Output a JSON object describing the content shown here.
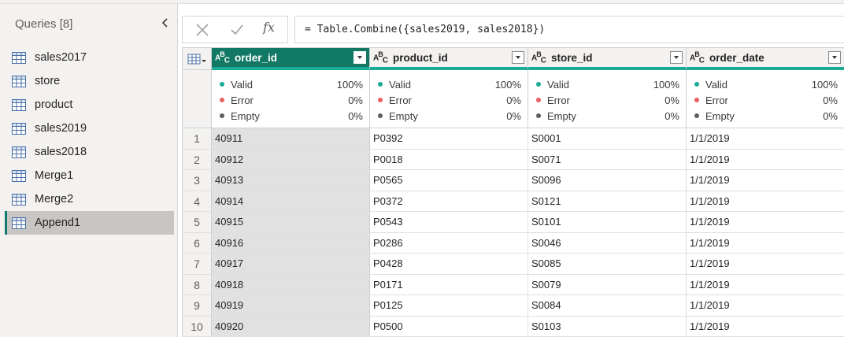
{
  "queries": {
    "title": "Queries [8]",
    "items": [
      {
        "label": "sales2017",
        "selected": false
      },
      {
        "label": "store",
        "selected": false
      },
      {
        "label": "product",
        "selected": false
      },
      {
        "label": "sales2019",
        "selected": false
      },
      {
        "label": "sales2018",
        "selected": false
      },
      {
        "label": "Merge1",
        "selected": false
      },
      {
        "label": "Merge2",
        "selected": false
      },
      {
        "label": "Append1",
        "selected": true
      }
    ]
  },
  "formula_bar": {
    "cancel_icon": "close-icon",
    "commit_icon": "check-icon",
    "function_icon": "fx-icon",
    "function_label": "fx",
    "formula": "= Table.Combine({sales2019, sales2018})"
  },
  "grid": {
    "columns": [
      {
        "name": "order_id",
        "type": "ABC",
        "selected": true,
        "profile": {
          "valid": "100%",
          "error": "0%",
          "empty": "0%"
        }
      },
      {
        "name": "product_id",
        "type": "ABC",
        "selected": false,
        "profile": {
          "valid": "100%",
          "error": "0%",
          "empty": "0%"
        }
      },
      {
        "name": "store_id",
        "type": "ABC",
        "selected": false,
        "profile": {
          "valid": "100%",
          "error": "0%",
          "empty": "0%"
        }
      },
      {
        "name": "order_date",
        "type": "ABC",
        "selected": false,
        "profile": {
          "valid": "100%",
          "error": "0%",
          "empty": "0%"
        }
      }
    ],
    "profile_labels": {
      "valid": "Valid",
      "error": "Error",
      "empty": "Empty"
    },
    "profile_colors": {
      "valid": "#1aab97",
      "error": "#e8615e",
      "empty": "#605e5c"
    },
    "rows": [
      {
        "n": "1",
        "cells": [
          "40911",
          "P0392",
          "S0001",
          "1/1/2019"
        ]
      },
      {
        "n": "2",
        "cells": [
          "40912",
          "P0018",
          "S0071",
          "1/1/2019"
        ]
      },
      {
        "n": "3",
        "cells": [
          "40913",
          "P0565",
          "S0096",
          "1/1/2019"
        ]
      },
      {
        "n": "4",
        "cells": [
          "40914",
          "P0372",
          "S0121",
          "1/1/2019"
        ]
      },
      {
        "n": "5",
        "cells": [
          "40915",
          "P0543",
          "S0101",
          "1/1/2019"
        ]
      },
      {
        "n": "6",
        "cells": [
          "40916",
          "P0286",
          "S0046",
          "1/1/2019"
        ]
      },
      {
        "n": "7",
        "cells": [
          "40917",
          "P0428",
          "S0085",
          "1/1/2019"
        ]
      },
      {
        "n": "8",
        "cells": [
          "40918",
          "P0171",
          "S0079",
          "1/1/2019"
        ]
      },
      {
        "n": "9",
        "cells": [
          "40919",
          "P0125",
          "S0084",
          "1/1/2019"
        ]
      },
      {
        "n": "10",
        "cells": [
          "40920",
          "P0500",
          "S0103",
          "1/1/2019"
        ]
      }
    ]
  },
  "colors": {
    "accent": "#117865",
    "profile_bar": "#1aab97",
    "selected_query_marker": "#107c6d"
  }
}
